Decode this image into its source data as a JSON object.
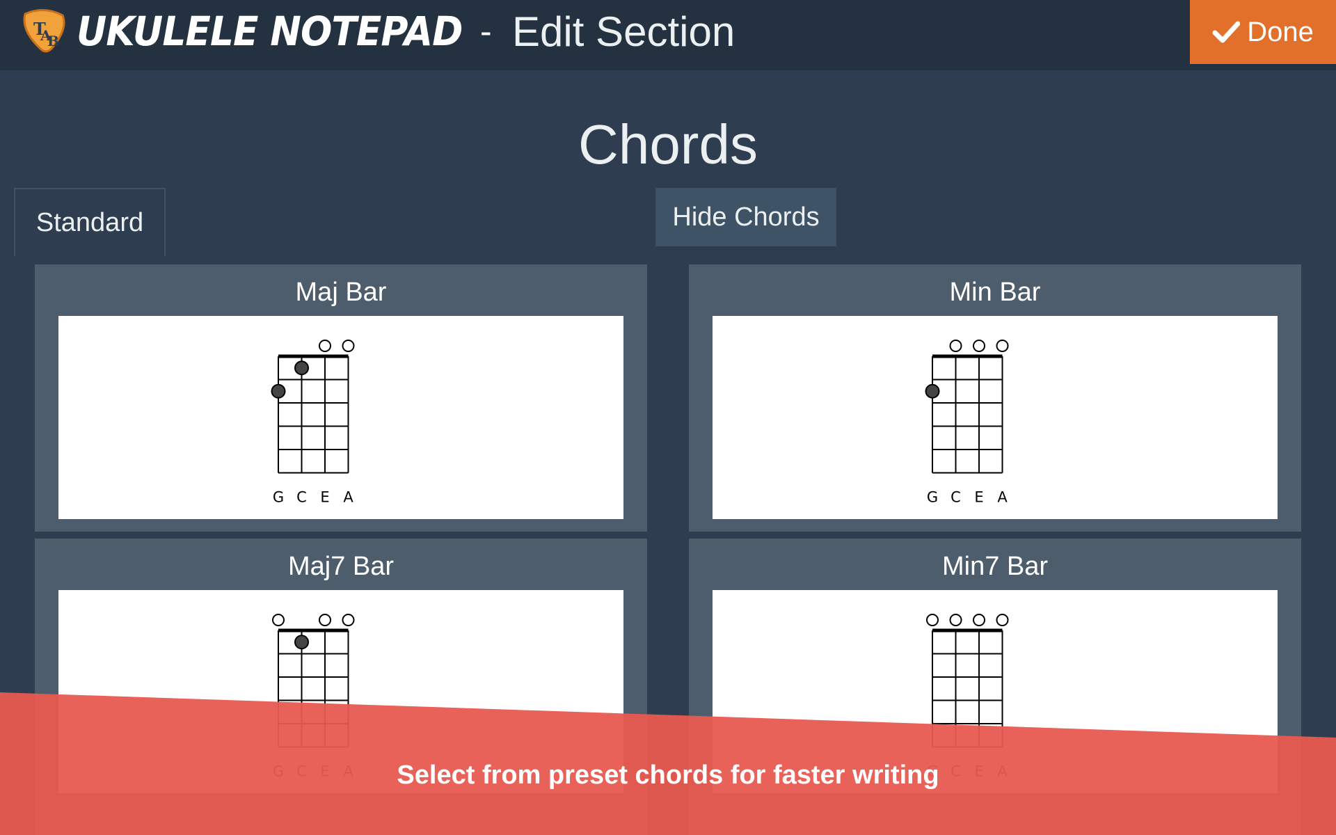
{
  "header": {
    "app_title": "Ukulele Notepad",
    "separator": "-",
    "page_title": "Edit Section",
    "done_label": "Done",
    "done_icon": "checkmark-icon",
    "logo_icon": "tab-pick-logo",
    "accent_color": "#e2702a",
    "bg_color": "#243140"
  },
  "section": {
    "title": "Chords",
    "tab_label": "Standard",
    "hide_chords_label": "Hide Chords"
  },
  "chords": [
    {
      "name": "Maj Bar",
      "strings": [
        "G",
        "C",
        "E",
        "A"
      ],
      "open": [
        2,
        3
      ],
      "fingers": [
        {
          "string": 1,
          "fret": 1
        },
        {
          "string": 0,
          "fret": 2
        }
      ]
    },
    {
      "name": "Min Bar",
      "strings": [
        "G",
        "C",
        "E",
        "A"
      ],
      "open": [
        1,
        2,
        3
      ],
      "fingers": [
        {
          "string": 0,
          "fret": 2
        }
      ]
    },
    {
      "name": "Maj7 Bar",
      "strings": [
        "G",
        "C",
        "E",
        "A"
      ],
      "open": [
        0,
        2,
        3
      ],
      "fingers": [
        {
          "string": 1,
          "fret": 1
        }
      ]
    },
    {
      "name": "Min7 Bar",
      "strings": [
        "G",
        "C",
        "E",
        "A"
      ],
      "open": [
        0,
        1,
        2,
        3
      ],
      "fingers": []
    }
  ],
  "tip": {
    "text": "Select from preset chords for faster writing",
    "color": "#e85a50"
  }
}
